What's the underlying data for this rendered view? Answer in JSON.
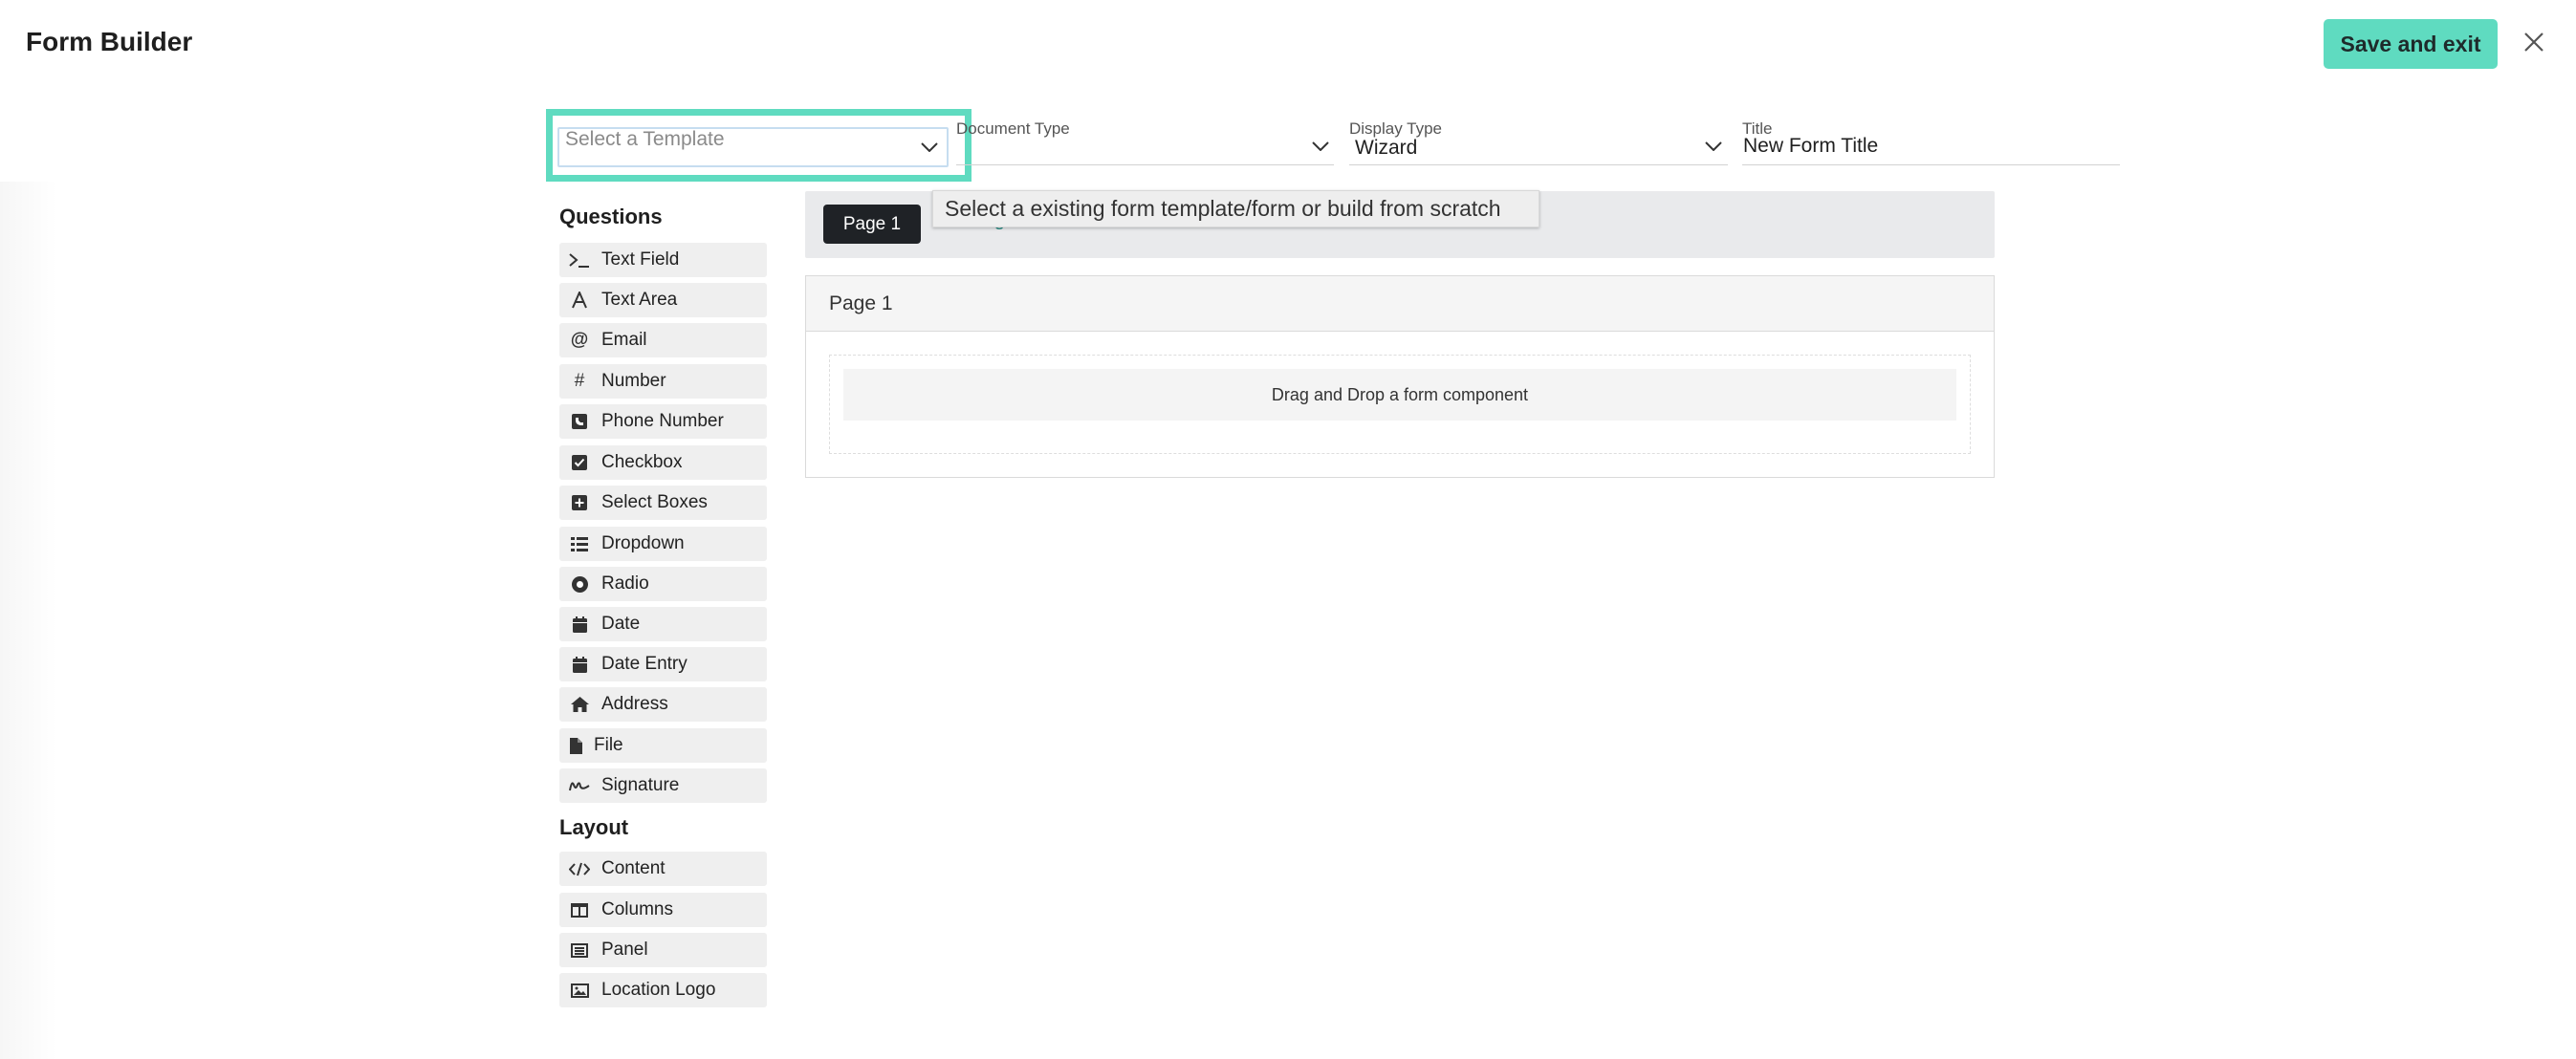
{
  "header": {
    "title": "Form Builder",
    "save_label": "Save and exit"
  },
  "fields": {
    "template": {
      "placeholder": "Select a Template"
    },
    "document_type": {
      "label": "Document Type",
      "value": ""
    },
    "display_type": {
      "label": "Display Type",
      "value": "Wizard"
    },
    "title": {
      "label": "Title",
      "value": "New Form Title"
    }
  },
  "tooltip": "Select a existing form template/form or build from scratch",
  "palette": {
    "questions_heading": "Questions",
    "questions": [
      {
        "label": "Text Field",
        "icon": "terminal-icon"
      },
      {
        "label": "Text Area",
        "icon": "font-icon"
      },
      {
        "label": "Email",
        "icon": "at-icon"
      },
      {
        "label": "Number",
        "icon": "hash-icon"
      },
      {
        "label": "Phone Number",
        "icon": "phone-square-icon"
      },
      {
        "label": "Checkbox",
        "icon": "check-square-icon"
      },
      {
        "label": "Select Boxes",
        "icon": "plus-square-icon"
      },
      {
        "label": "Dropdown",
        "icon": "list-icon"
      },
      {
        "label": "Radio",
        "icon": "dot-circle-icon"
      },
      {
        "label": "Date",
        "icon": "calendar-icon"
      },
      {
        "label": "Date Entry",
        "icon": "calendar-icon"
      },
      {
        "label": "Address",
        "icon": "home-icon"
      },
      {
        "label": "File",
        "icon": "file-icon"
      },
      {
        "label": "Signature",
        "icon": "signature-icon"
      }
    ],
    "layout_heading": "Layout",
    "layout": [
      {
        "label": "Content",
        "icon": "code-icon"
      },
      {
        "label": "Columns",
        "icon": "columns-icon"
      },
      {
        "label": "Panel",
        "icon": "list-alt-icon"
      },
      {
        "label": "Location Logo",
        "icon": "image-icon"
      }
    ]
  },
  "pages": {
    "tab_label": "Page 1",
    "add_label": "+ Page"
  },
  "canvas": {
    "panel_title": "Page 1",
    "drop_hint": "Drag and Drop a form component"
  },
  "colors": {
    "accent": "#5fdbc0",
    "tab_dark": "#1f2226",
    "link": "#2a8f86"
  }
}
